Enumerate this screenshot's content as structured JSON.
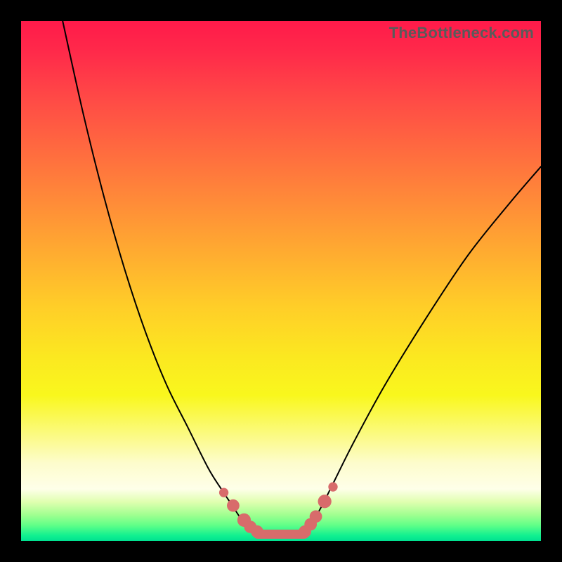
{
  "watermark": "TheBottleneck.com",
  "chart_data": {
    "type": "line",
    "title": "",
    "xlabel": "",
    "ylabel": "",
    "xlim": [
      0,
      100
    ],
    "ylim": [
      0,
      100
    ],
    "series": [
      {
        "name": "left-curve",
        "x": [
          8,
          12,
          16,
          20,
          24,
          28,
          32,
          36,
          38.5,
          40.5,
          42.5,
          44,
          45.5
        ],
        "values": [
          100,
          82,
          66,
          52,
          40,
          30,
          22,
          14,
          10,
          7,
          4,
          2.5,
          1.5
        ]
      },
      {
        "name": "right-curve",
        "x": [
          54.5,
          56,
          58,
          60,
          64,
          70,
          78,
          86,
          94,
          100
        ],
        "values": [
          1.5,
          3.5,
          7,
          11,
          19,
          30,
          43,
          55,
          65,
          72
        ]
      }
    ],
    "valley": {
      "x_start": 45.5,
      "x_end": 54.5,
      "y": 1.3
    },
    "markers": [
      {
        "x": 39,
        "y": 9.3,
        "r": 0.9
      },
      {
        "x": 40.8,
        "y": 6.8,
        "r": 1.2
      },
      {
        "x": 42.9,
        "y": 4.0,
        "r": 1.3
      },
      {
        "x": 44.1,
        "y": 2.7,
        "r": 1.2
      },
      {
        "x": 45.4,
        "y": 1.8,
        "r": 1.2
      },
      {
        "x": 54.6,
        "y": 1.8,
        "r": 1.2
      },
      {
        "x": 55.7,
        "y": 3.2,
        "r": 1.2
      },
      {
        "x": 56.7,
        "y": 4.7,
        "r": 1.2
      },
      {
        "x": 58.4,
        "y": 7.6,
        "r": 1.3
      },
      {
        "x": 60.0,
        "y": 10.4,
        "r": 0.9
      }
    ]
  }
}
